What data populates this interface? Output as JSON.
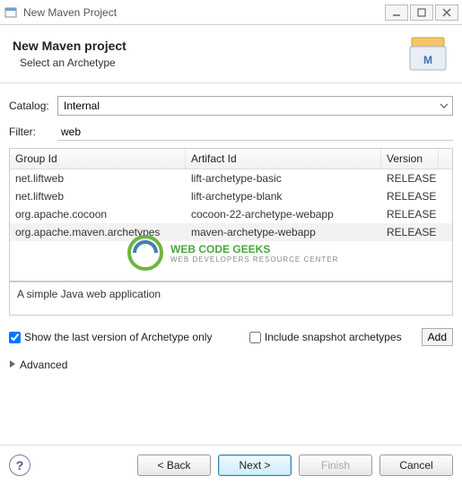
{
  "window": {
    "title": "New Maven Project"
  },
  "header": {
    "title": "New Maven project",
    "subtitle": "Select an Archetype"
  },
  "form": {
    "catalog_label": "Catalog:",
    "catalog_value": "Internal",
    "filter_label": "Filter:",
    "filter_value": "web"
  },
  "table": {
    "headers": {
      "groupId": "Group Id",
      "artifactId": "Artifact Id",
      "version": "Version"
    },
    "rows": [
      {
        "groupId": "net.liftweb",
        "artifactId": "lift-archetype-basic",
        "version": "RELEASE"
      },
      {
        "groupId": "net.liftweb",
        "artifactId": "lift-archetype-blank",
        "version": "RELEASE"
      },
      {
        "groupId": "org.apache.cocoon",
        "artifactId": "cocoon-22-archetype-webapp",
        "version": "RELEASE"
      },
      {
        "groupId": "org.apache.maven.archetypes",
        "artifactId": "maven-archetype-webapp",
        "version": "RELEASE"
      }
    ],
    "selectedIndex": 3
  },
  "description": "A simple Java web application",
  "options": {
    "lastVersionOnly_label": "Show the last version of Archetype only",
    "lastVersionOnly_checked": true,
    "includeSnapshot_label": "Include snapshot archetypes",
    "includeSnapshot_checked": false,
    "add_label": "Add"
  },
  "advanced_label": "Advanced",
  "buttons": {
    "back": "< Back",
    "next": "Next >",
    "finish": "Finish",
    "cancel": "Cancel"
  },
  "watermark": {
    "line1": "WEB CODE GEEKS",
    "line2": "WEB DEVELOPERS RESOURCE CENTER"
  }
}
